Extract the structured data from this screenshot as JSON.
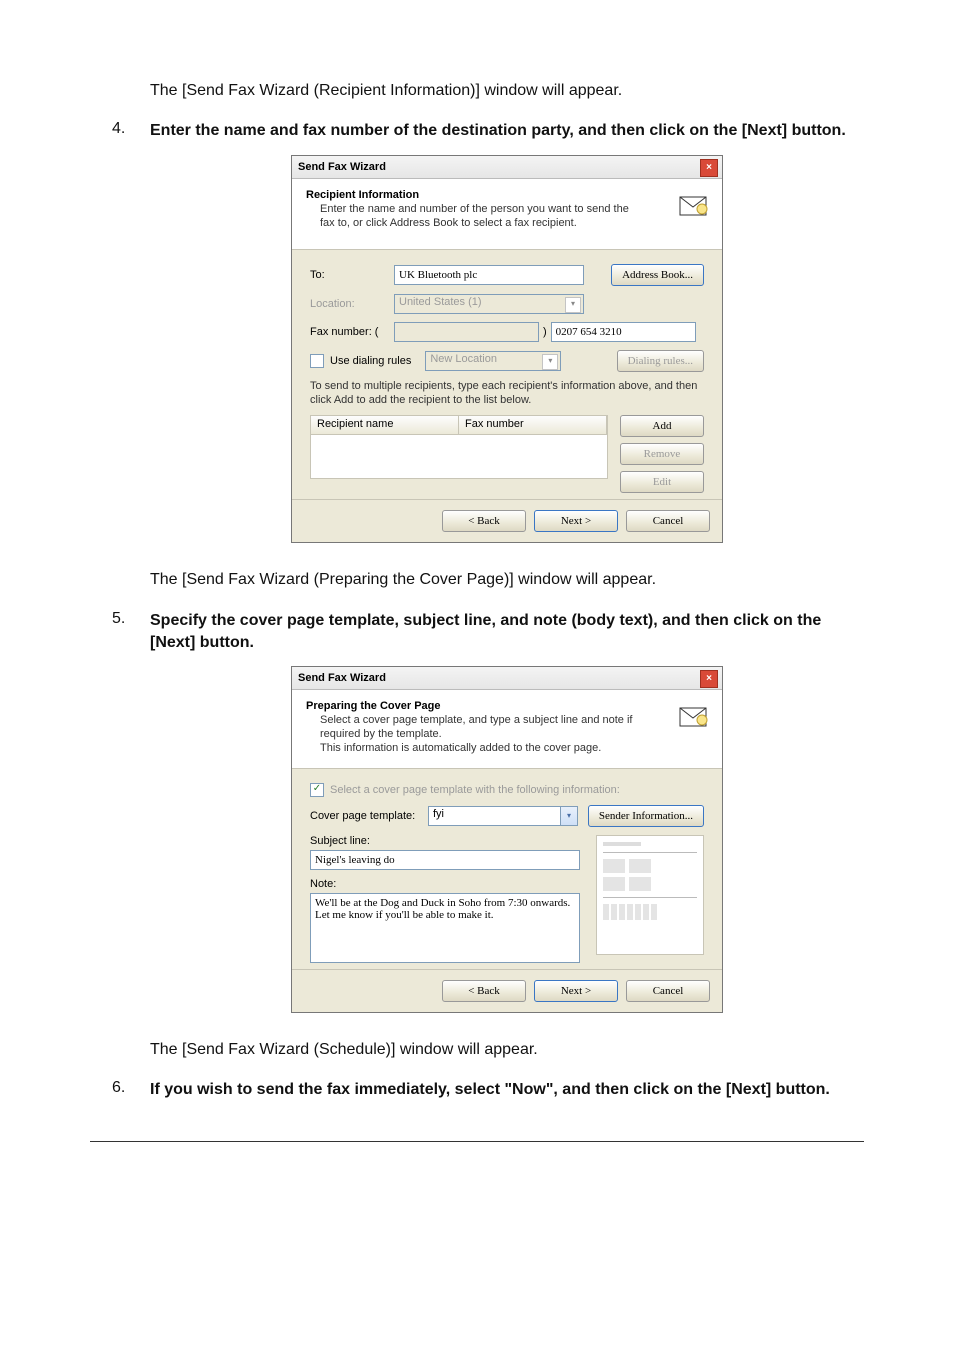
{
  "para1": "The [Send Fax Wizard (Recipient Information)] window will appear.",
  "step4": {
    "num": "4.",
    "text": "Enter the name and fax number of the destination party, and then click on the [Next] button."
  },
  "wiz1": {
    "title": "Send Fax Wizard",
    "head_big": "Recipient Information",
    "head_sub": "Enter the name and number of the person you want to send the fax to, or click Address Book to select a fax recipient.",
    "to_label": "To:",
    "to_value": "UK Bluetooth plc",
    "address_book": "Address Book...",
    "location_label": "Location:",
    "location_value": "United States (1)",
    "fax_label": "Fax number:  (",
    "fax_area": "",
    "fax_paren": ")",
    "fax_value": "0207 654 3210",
    "use_dialing": "Use dialing rules",
    "new_location": "New Location",
    "dialing_rules": "Dialing rules...",
    "note": "To send to multiple recipients, type each recipient's information above, and then click Add to add the recipient to the list below.",
    "col1": "Recipient name",
    "col2": "Fax number",
    "add": "Add",
    "remove": "Remove",
    "edit": "Edit",
    "back": "< Back",
    "next": "Next >",
    "cancel": "Cancel"
  },
  "para2": "The [Send Fax Wizard (Preparing the Cover Page)] window will appear.",
  "step5": {
    "num": "5.",
    "text": "Specify the cover page template, subject line, and note (body text), and then click on the [Next] button."
  },
  "wiz2": {
    "title": "Send Fax Wizard",
    "head_big": "Preparing the Cover Page",
    "head_sub": "Select a cover page template, and type a subject line and note if required by the template.\nThis information is automatically added to the cover page.",
    "select_template": "Select a cover page template with the following information:",
    "template_label": "Cover page template:",
    "template_value": "fyi",
    "sender_info": "Sender Information...",
    "subject_label": "Subject line:",
    "subject_value": "Nigel's leaving do",
    "note_label": "Note:",
    "note_value": "We'll be at the Dog and Duck in Soho from 7:30 onwards.\nLet me know if you'll be able to make it.",
    "back": "< Back",
    "next": "Next >",
    "cancel": "Cancel"
  },
  "para3": "The [Send Fax Wizard (Schedule)] window will appear.",
  "step6": {
    "num": "6.",
    "text": "If you wish to send the fax immediately, select \"Now\", and then click on the [Next] button."
  }
}
